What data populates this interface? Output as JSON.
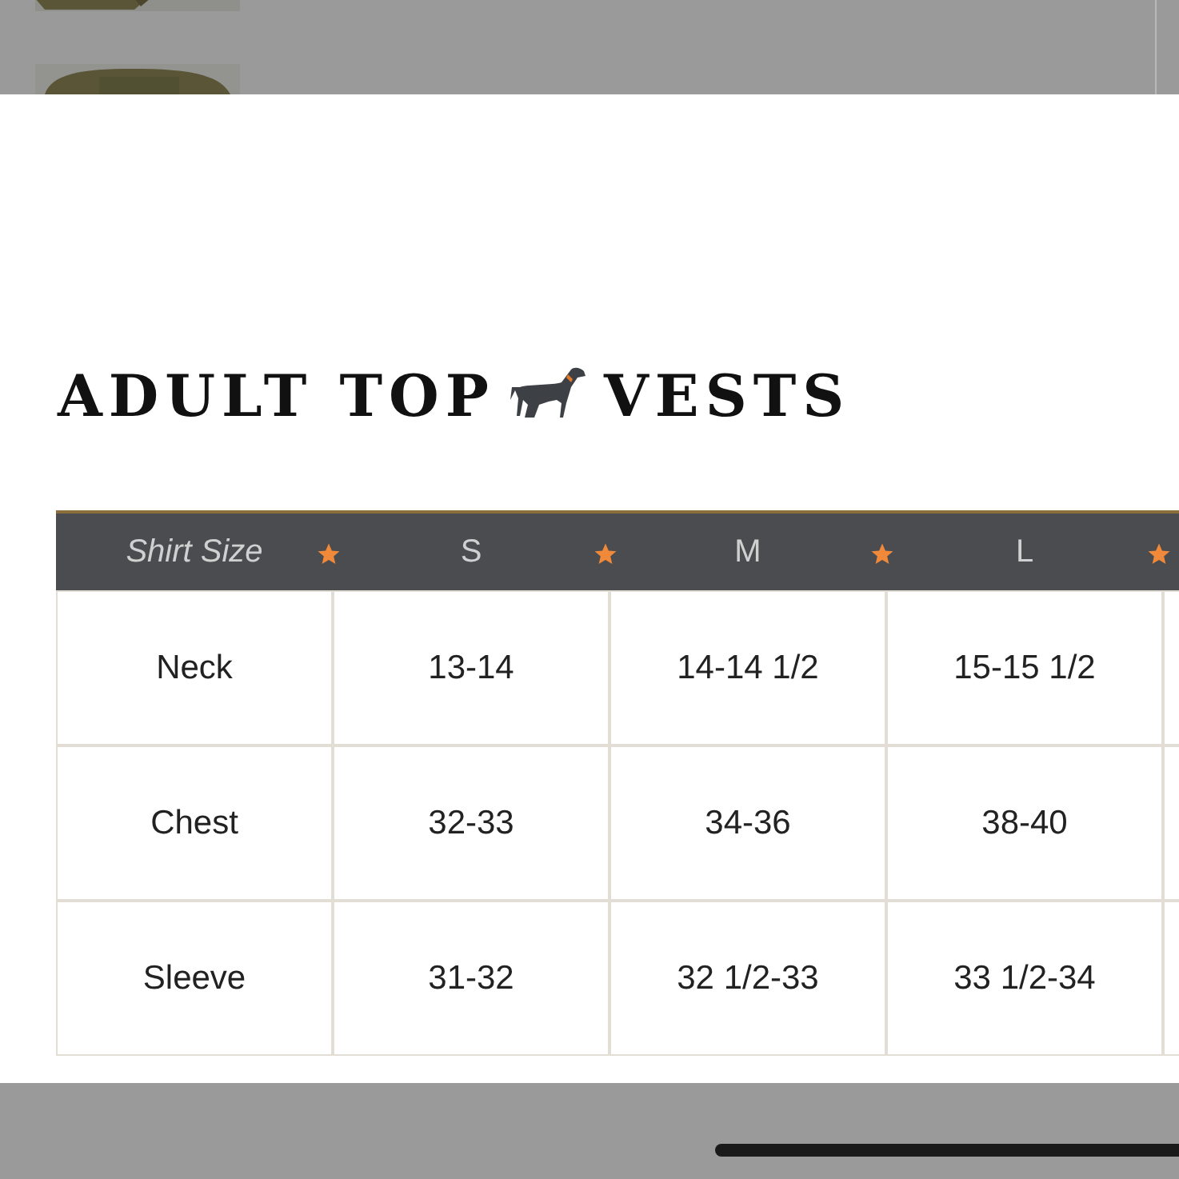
{
  "title": {
    "before": "ADULT TOP",
    "after": "VESTS"
  },
  "table": {
    "columns": [
      "Shirt Size",
      "S",
      "M",
      "L"
    ],
    "rows": [
      {
        "label": "Neck",
        "values": [
          "13-14",
          "14-14 1/2",
          "15-15 1/2"
        ]
      },
      {
        "label": "Chest",
        "values": [
          "32-33",
          "34-36",
          "38-40"
        ]
      },
      {
        "label": "Sleeve",
        "values": [
          "31-32",
          "32 1/2-33",
          "33 1/2-34"
        ]
      }
    ]
  }
}
